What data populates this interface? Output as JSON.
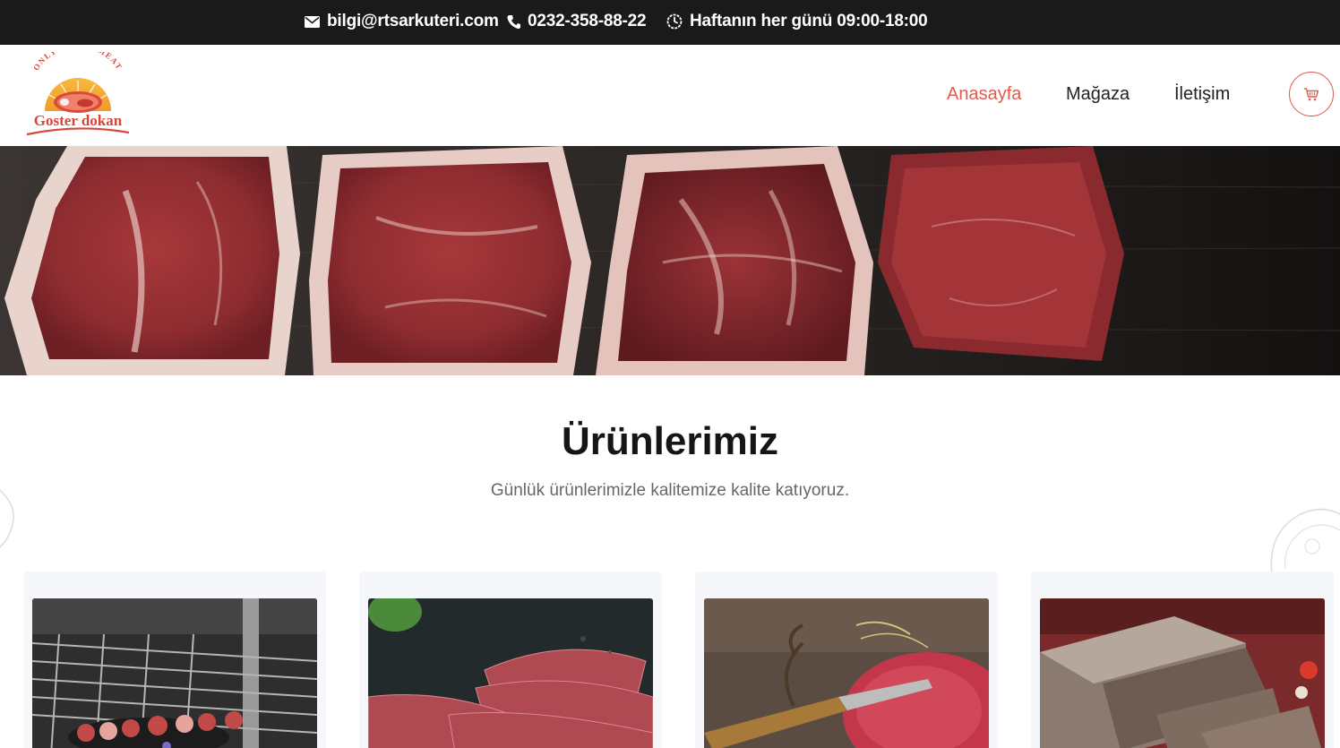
{
  "topbar": {
    "email": "bilgi@rtsarkuteri.com",
    "phone": "0232-358-88-22",
    "hours": "Haftanın her günü 09:00-18:00"
  },
  "logo": {
    "arc_text": "ONLY FRESH MEAT",
    "brand": "Goster dokan"
  },
  "nav": {
    "items": [
      {
        "label": "Anasayfa",
        "active": true
      },
      {
        "label": "Mağaza",
        "active": false
      },
      {
        "label": "İletişim",
        "active": false
      }
    ],
    "cart_icon": "cart-icon"
  },
  "products": {
    "title": "Ürünlerimiz",
    "subtitle": "Günlük ürünlerimizle kalitemize kalite katıyoruz."
  },
  "colors": {
    "accent": "#e05a4f",
    "topbar_bg": "#1a1a1a",
    "card_bg": "#f6f7fb"
  }
}
